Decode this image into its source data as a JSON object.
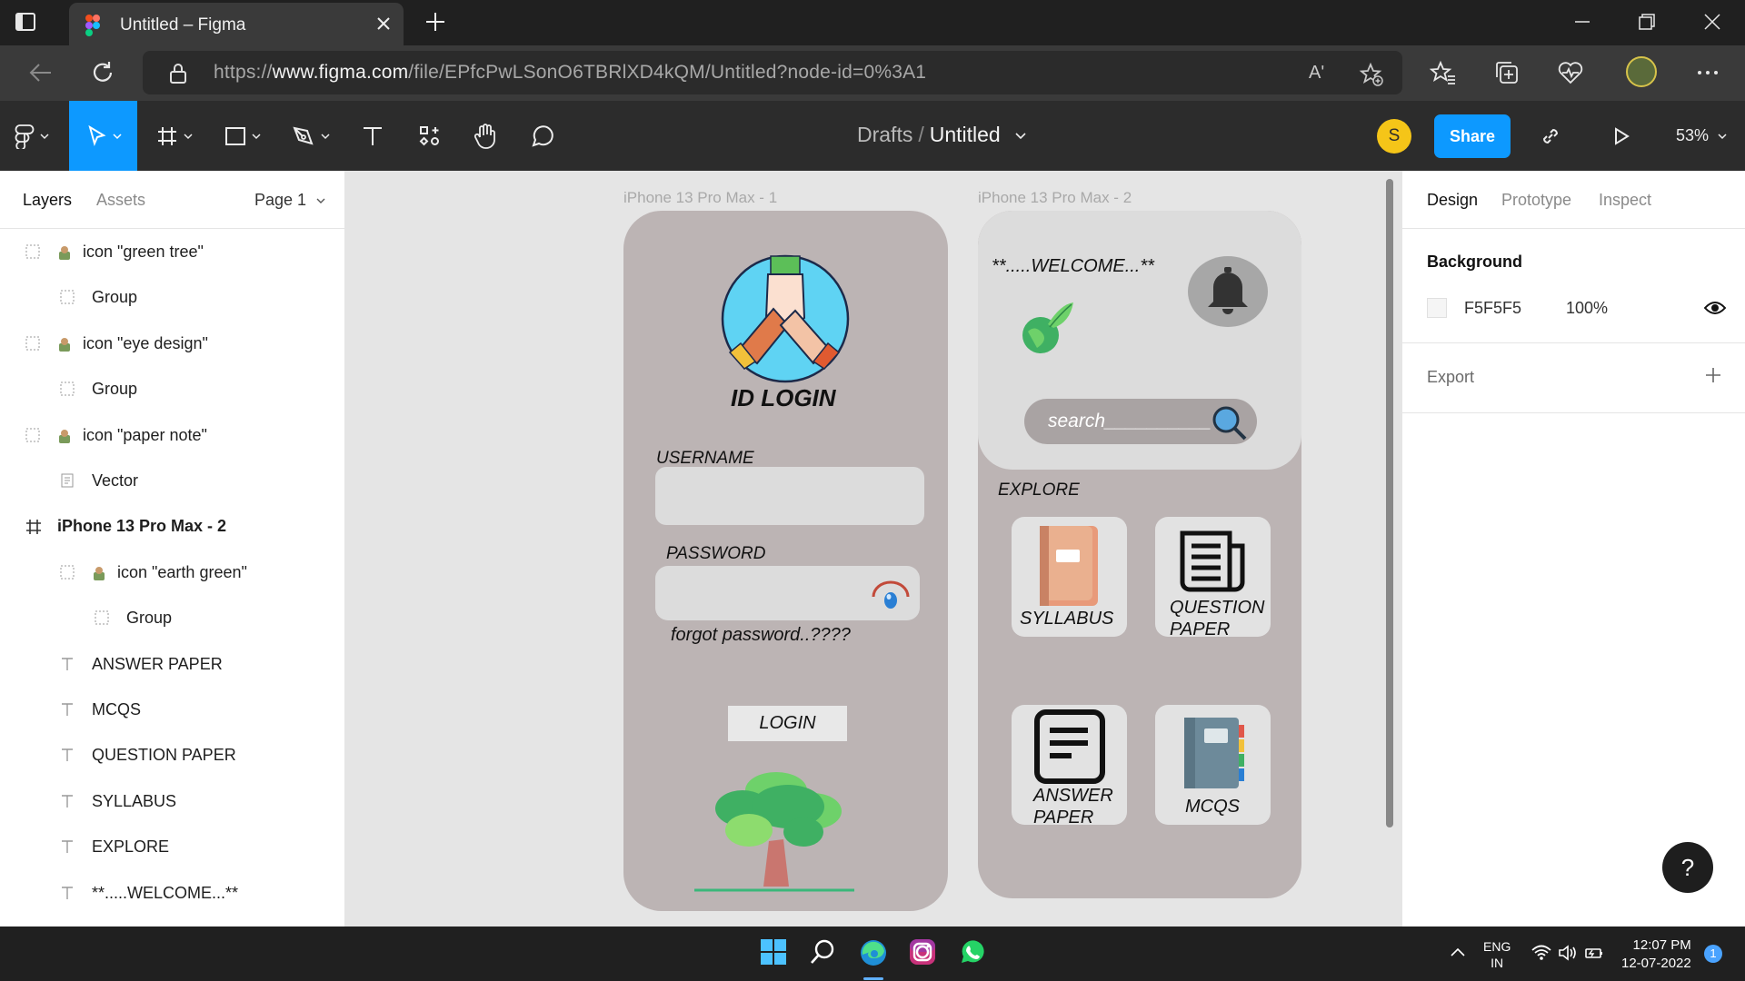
{
  "browser": {
    "tab_title": "Untitled – Figma",
    "url_host": "www.figma.com",
    "url_prefix": "https://",
    "url_rest": "/file/EPfcPwLSonO6TBRlXD4kQM/Untitled?node-id=0%3A1",
    "read_aloud_glyph": "Aʹ"
  },
  "figma_toolbar": {
    "breadcrumb_folder": "Drafts",
    "breadcrumb_sep": "/",
    "file_name": "Untitled",
    "user_initial": "S",
    "share_label": "Share",
    "zoom": "53%"
  },
  "left_panel": {
    "tab_layers": "Layers",
    "tab_assets": "Assets",
    "page_selector": "Page 1",
    "layers": [
      {
        "label": "icon \"green tree\"",
        "kind": "component"
      },
      {
        "label": "Group",
        "kind": "group"
      },
      {
        "label": "icon \"eye design\"",
        "kind": "component"
      },
      {
        "label": "Group",
        "kind": "group"
      },
      {
        "label": "icon \"paper note\"",
        "kind": "component"
      },
      {
        "label": "Vector",
        "kind": "vector"
      },
      {
        "label": "iPhone 13 Pro Max - 2",
        "kind": "frame"
      },
      {
        "label": "icon \"earth green\"",
        "kind": "component"
      },
      {
        "label": "Group",
        "kind": "group"
      },
      {
        "label": "ANSWER PAPER",
        "kind": "text"
      },
      {
        "label": "MCQS",
        "kind": "text"
      },
      {
        "label": "QUESTION PAPER",
        "kind": "text"
      },
      {
        "label": "SYLLABUS",
        "kind": "text"
      },
      {
        "label": "EXPLORE",
        "kind": "text"
      },
      {
        "label": "**.....WELCOME...**",
        "kind": "text"
      }
    ]
  },
  "canvas": {
    "frame1": {
      "name": "iPhone 13 Pro Max - 1",
      "title": "ID LOGIN",
      "username_label": "USERNAME",
      "password_label": "PASSWORD",
      "forgot": "forgot password..????",
      "login": "LOGIN"
    },
    "frame2": {
      "name": "iPhone 13 Pro Max - 2",
      "welcome": "**.....WELCOME...**",
      "search_placeholder": "search__________",
      "explore": "EXPLORE",
      "cards": {
        "syllabus": "SYLLABUS",
        "question_1": "QUESTION",
        "question_2": "PAPER",
        "answer_1": "ANSWER",
        "answer_2": "PAPER",
        "mcqs": "MCQS"
      }
    },
    "background_color": "#e5e5e5",
    "frame_color": "#bcb4b4"
  },
  "right_panel": {
    "tab_design": "Design",
    "tab_prototype": "Prototype",
    "tab_inspect": "Inspect",
    "background_heading": "Background",
    "background_hex": "F5F5F5",
    "background_opacity": "100%",
    "export_heading": "Export"
  },
  "help_label": "?",
  "taskbar": {
    "lang_1": "ENG",
    "lang_2": "IN",
    "time": "12:07 PM",
    "date": "12-07-2022",
    "notification_count": "1"
  },
  "colors": {
    "figma_blue": "#0d99ff",
    "toolbar_bg": "#2c2c2c",
    "avatar_yellow": "#f5c518"
  }
}
